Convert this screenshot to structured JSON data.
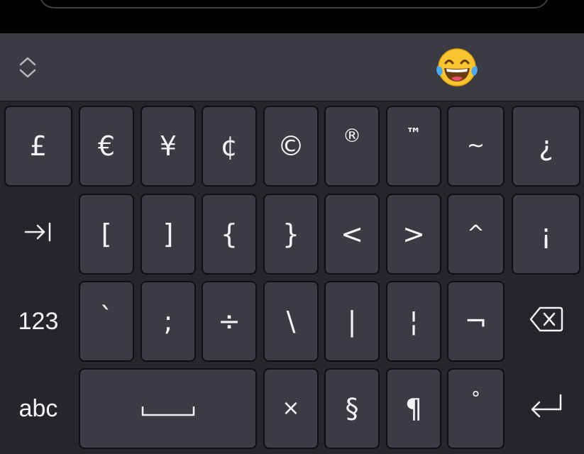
{
  "toolbar": {
    "expand_icon": "expand-collapse-icon",
    "emoji": "😂"
  },
  "rows": {
    "row1": [
      "£",
      "€",
      "¥",
      "¢",
      "©",
      "®",
      "™",
      "~",
      "¿"
    ],
    "row2": [
      "[",
      "]",
      "{",
      "}",
      "<",
      ">",
      "^",
      "¡"
    ],
    "row3": [
      "`",
      ";",
      "÷",
      "\\",
      "|",
      "¦",
      "¬"
    ],
    "row4": [
      "×",
      "§",
      "¶",
      "°"
    ]
  },
  "function_keys": {
    "tab_icon": "tab-icon",
    "numbers_label": "123",
    "backspace_icon": "backspace-icon",
    "abc_label": "abc",
    "space_icon": "space-icon",
    "enter_icon": "enter-icon"
  }
}
